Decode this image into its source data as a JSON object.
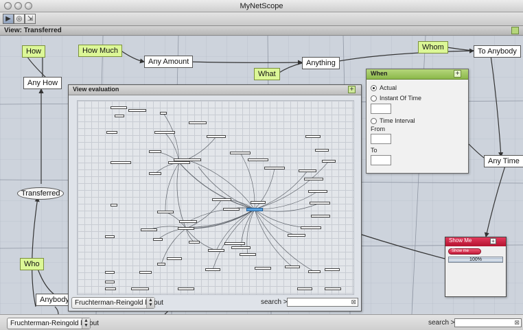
{
  "window": {
    "title": "MyNetScope"
  },
  "toolbar": {
    "tools": [
      "select-tool",
      "graph-tool",
      "export-tool"
    ]
  },
  "view": {
    "label": "View: Transferred"
  },
  "nodes": {
    "how": "How",
    "how_much": "How Much",
    "any_amount": "Any Amount",
    "what": "What",
    "anything": "Anything",
    "whom": "Whom",
    "to_anybody": "To Anybody",
    "any_how": "Any How",
    "transferred": "Transferred",
    "any_time": "Any Time",
    "who": "Who",
    "anybody": "Anybody"
  },
  "evaluation": {
    "title": "View evaluation",
    "layout": "Fruchterman-Reingold layout",
    "search_label": "search >>",
    "search_value": ""
  },
  "when": {
    "title": "When",
    "option_actual": "Actual",
    "option_instant": "Instant Of Time",
    "option_interval": "Time Interval",
    "from_label": "From",
    "to_label": "To",
    "selected": "Actual"
  },
  "show_me": {
    "title": "Show Me",
    "button": "Show me",
    "progress": "100%"
  },
  "bottom": {
    "layout": "Fruchterman-Reingold layout",
    "search_label": "search >>",
    "search_value": ""
  }
}
